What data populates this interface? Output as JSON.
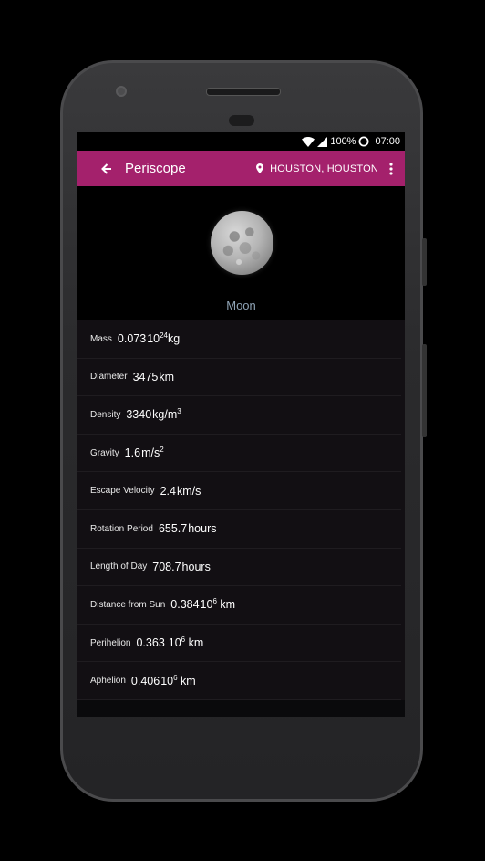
{
  "status_bar": {
    "battery": "100%",
    "time": "07:00"
  },
  "app_bar": {
    "title": "Periscope",
    "location": "HOUSTON, HOUSTON"
  },
  "colors": {
    "app_bar": "#a4216c",
    "body_name": "#8fa3b5",
    "background": "#0a0a0c"
  },
  "body": {
    "name": "Moon"
  },
  "properties": [
    {
      "label": "Mass",
      "value": "0.073",
      "unit_base": "10",
      "unit_sup": "24",
      "unit_suffix": "kg"
    },
    {
      "label": "Diameter",
      "value": "3475",
      "unit_base": "km",
      "unit_sup": "",
      "unit_suffix": ""
    },
    {
      "label": "Density",
      "value": "3340",
      "unit_base": "kg/m",
      "unit_sup": "3",
      "unit_suffix": ""
    },
    {
      "label": "Gravity",
      "value": "1.6",
      "unit_base": "m/s",
      "unit_sup": "2",
      "unit_suffix": ""
    },
    {
      "label": "Escape Velocity",
      "value": "2.4",
      "unit_base": "km/s",
      "unit_sup": "",
      "unit_suffix": ""
    },
    {
      "label": "Rotation Period",
      "value": "655.7",
      "unit_base": "hours",
      "unit_sup": "",
      "unit_suffix": ""
    },
    {
      "label": "Length of Day",
      "value": "708.7",
      "unit_base": "hours",
      "unit_sup": "",
      "unit_suffix": ""
    },
    {
      "label": "Distance from Sun",
      "value": "0.384",
      "unit_base": "10",
      "unit_sup": "6",
      "unit_suffix": " km"
    },
    {
      "label": "Perihelion",
      "value": "0.363",
      "unit_base": "10",
      "unit_sup": "6",
      "unit_suffix": " km"
    },
    {
      "label": "Aphelion",
      "value": "0.406",
      "unit_base": "10",
      "unit_sup": "6",
      "unit_suffix": " km"
    }
  ],
  "icons": {
    "back": "arrow-left-icon",
    "location": "map-pin-icon",
    "menu": "more-vert-icon",
    "wifi": "wifi-icon",
    "signal": "signal-icon",
    "battery": "battery-icon"
  }
}
